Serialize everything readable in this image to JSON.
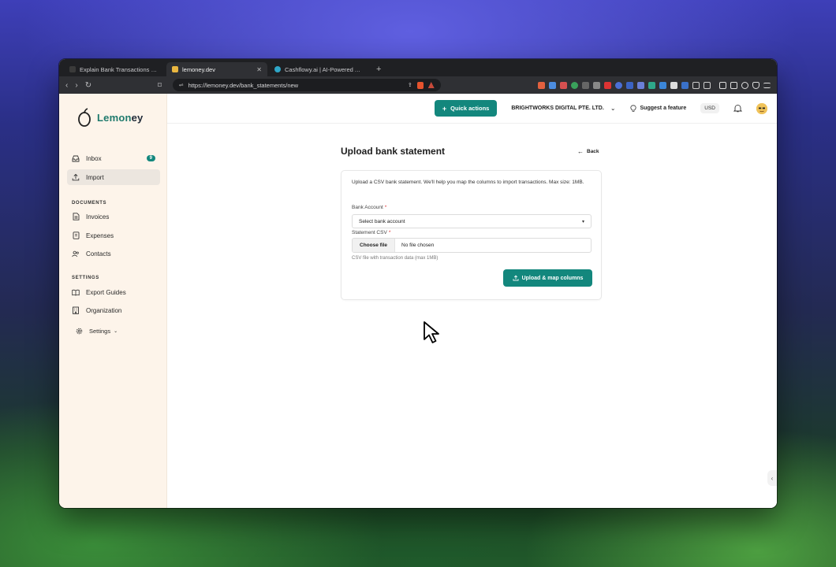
{
  "browser": {
    "tabs": [
      {
        "title": "Explain Bank Transactions Without",
        "active": false,
        "favicon_color": "#3a3a3a"
      },
      {
        "title": "lemoney.dev",
        "active": true,
        "favicon_color": "#e9b640"
      },
      {
        "title": "Cashflowy.ai | AI-Powered Accoun",
        "active": false,
        "favicon_color": "#2fa7c8"
      }
    ],
    "url": "https://lemoney.dev/bank_statements/new"
  },
  "sidebar": {
    "logo": "Lemoney",
    "logo_parts": [
      "Lemon",
      "ey"
    ],
    "items_top": [
      {
        "label": "Inbox",
        "icon": "inbox-icon",
        "badge": "9"
      },
      {
        "label": "Import",
        "icon": "upload-icon",
        "active": true
      }
    ],
    "documents_label": "DOCUMENTS",
    "documents": [
      {
        "label": "Invoices",
        "icon": "file-icon"
      },
      {
        "label": "Expenses",
        "icon": "receipt-icon"
      },
      {
        "label": "Contacts",
        "icon": "users-icon"
      }
    ],
    "settings_label": "SETTINGS",
    "settings": [
      {
        "label": "Export Guides",
        "icon": "book-icon"
      },
      {
        "label": "Organization",
        "icon": "building-icon"
      }
    ],
    "settings_toggle": "Settings"
  },
  "topbar": {
    "quick_actions": "Quick actions",
    "company": "BRIGHTWORKS DIGITAL PTE. LTD.",
    "suggest": "Suggest a feature",
    "currency": "USD"
  },
  "page": {
    "title": "Upload bank statement",
    "back": "Back",
    "intro": "Upload a CSV bank statement. We'll help you map the columns to import transactions. Max size: 1MB.",
    "bank_account_label": "Bank Account",
    "bank_account_value": "Select bank account",
    "statement_label": "Statement CSV",
    "choose_file": "Choose file",
    "no_file": "No file chosen",
    "hint": "CSV file with transaction data (max 1MB)",
    "upload_button": "Upload & map columns",
    "required_mark": "*"
  },
  "colors": {
    "accent": "#13877d",
    "sidebar_bg": "#fdf4ea"
  }
}
